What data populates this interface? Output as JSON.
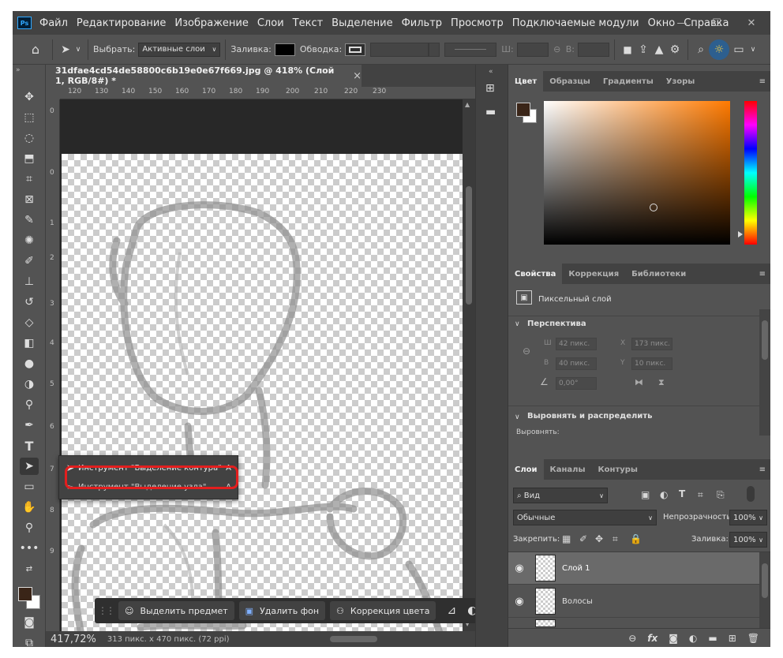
{
  "app": {
    "logo": "Ps"
  },
  "menu": [
    "Файл",
    "Редактирование",
    "Изображение",
    "Слои",
    "Текст",
    "Выделение",
    "Фильтр",
    "Просмотр",
    "Подключаемые модули",
    "Окно",
    "Справка"
  ],
  "options": {
    "select_label": "Выбрать:",
    "select_value": "Активные слои",
    "fill_label": "Заливка:",
    "stroke_label": "Обводка:",
    "w_label": "Ш:",
    "h_label": "В:"
  },
  "document": {
    "tab_title": "31dfae4cd54de58800c6b19e0e67f669.jpg @ 418% (Слой 1, RGB/8#) *",
    "close": "×",
    "ruler_h": [
      "120",
      "130",
      "140",
      "150",
      "160",
      "170",
      "180",
      "190",
      "200",
      "210",
      "220",
      "230"
    ],
    "ruler_v": [
      "0",
      "0",
      "1",
      "2",
      "3",
      "4",
      "5",
      "6",
      "7",
      "8",
      "9"
    ],
    "status_zoom": "417,72%",
    "status_info": "313 пикс. x 470 пикс. (72 ppi)"
  },
  "flyout": {
    "item1": "Инструмент \"Выделение контура\"",
    "item1_key": "A",
    "item2": "Инструмент \"Выделение узла\"",
    "item2_key": "A"
  },
  "contextbar": {
    "select_subject": "Выделить предмет",
    "remove_bg": "Удалить фон",
    "color_correction": "Коррекция цвета",
    "more": "•••"
  },
  "color_panel": {
    "tabs": [
      "Цвет",
      "Образцы",
      "Градиенты",
      "Узоры"
    ],
    "fg_color": "#3a2518",
    "hue_color": "#ff7a00"
  },
  "properties_panel": {
    "tabs": [
      "Свойства",
      "Коррекция",
      "Библиотеки"
    ],
    "layer_type": "Пиксельный слой",
    "perspective_title": "Перспектива",
    "w_label": "Ш",
    "w_value": "42 пикс.",
    "x_label": "X",
    "x_value": "173 пикс.",
    "h_label": "В",
    "h_value": "40 пикс.",
    "y_label": "Y",
    "y_value": "10 пикс.",
    "angle_value": "0,00°",
    "align_title": "Выровнять и распределить",
    "align_label": "Выровнять:"
  },
  "layers_panel": {
    "tabs": [
      "Слои",
      "Каналы",
      "Контуры"
    ],
    "kind_filter": "Вид",
    "blend_mode": "Обычные",
    "opacity_label": "Непрозрачность:",
    "opacity_value": "100%",
    "lock_label": "Закрепить:",
    "fill_label": "Заливка:",
    "fill_value": "100%",
    "layers": [
      {
        "name": "Слой 1",
        "selected": true
      },
      {
        "name": "Волосы",
        "selected": false
      }
    ]
  }
}
